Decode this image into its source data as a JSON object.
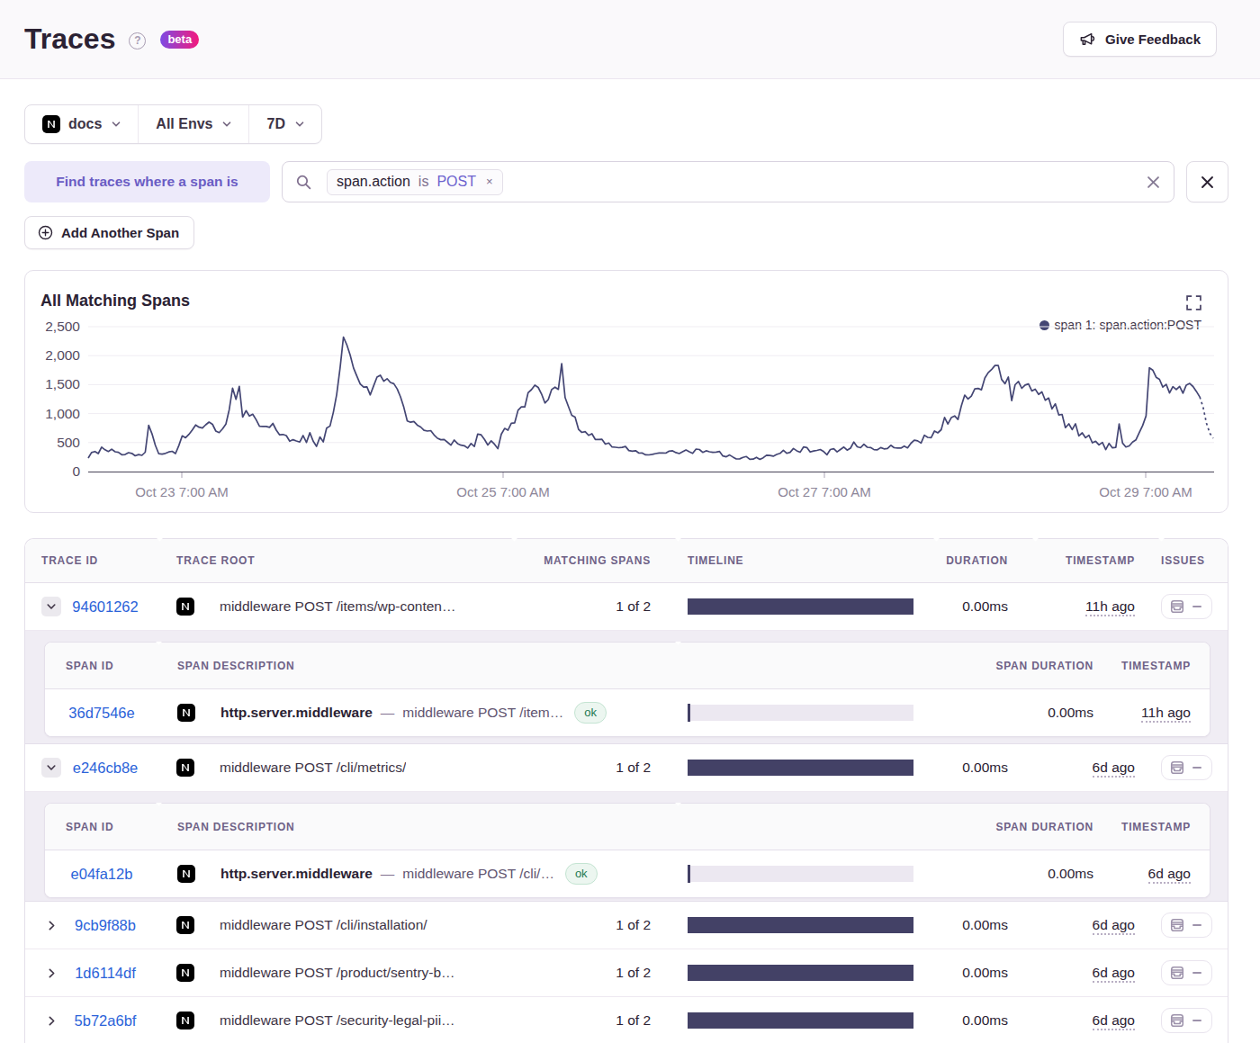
{
  "header": {
    "title": "Traces",
    "beta_label": "beta",
    "feedback_label": "Give Feedback"
  },
  "filters": {
    "project": "docs",
    "environment": "All Envs",
    "date_range": "7D"
  },
  "search": {
    "span_label": "Find traces where a span is",
    "token": {
      "key": "span.action",
      "op": "is",
      "value": "POST",
      "remove": "×"
    },
    "add_span_label": "Add Another Span"
  },
  "chart_data": {
    "type": "line",
    "title": "All Matching Spans",
    "legend": [
      {
        "name": "span 1: span.action:POST",
        "color": "#444674"
      }
    ],
    "ylim": [
      0,
      2500
    ],
    "y_ticks": [
      {
        "value": 0,
        "label": "0"
      },
      {
        "value": 500,
        "label": "500"
      },
      {
        "value": 1000,
        "label": "1,000"
      },
      {
        "value": 1500,
        "label": "1,500"
      },
      {
        "value": 2000,
        "label": "2,000"
      },
      {
        "value": 2500,
        "label": "2,500"
      }
    ],
    "x_ticks": [
      {
        "frac": 0.0832,
        "label": "Oct 23 7:00 AM"
      },
      {
        "frac": 0.3688,
        "label": "Oct 25 7:00 AM"
      },
      {
        "frac": 0.6544,
        "label": "Oct 27 7:00 AM"
      },
      {
        "frac": 0.94,
        "label": "Oct 29 7:00 AM"
      }
    ],
    "dashed_tail_points": 4,
    "values": [
      233,
      328,
      347,
      310,
      422,
      376,
      346,
      387,
      342,
      332,
      290,
      293,
      326,
      313,
      271,
      294,
      280,
      334,
      800,
      651,
      455,
      307,
      301,
      313,
      338,
      350,
      310,
      448,
      617,
      584,
      641,
      717,
      805,
      766,
      752,
      807,
      854,
      815,
      699,
      673,
      738,
      820,
      1068,
      1440,
      1247,
      1470,
      939,
      1052,
      958,
      989,
      895,
      783,
      778,
      778,
      762,
      831,
      714,
      633,
      640,
      621,
      524,
      550,
      528,
      510,
      621,
      501,
      669,
      525,
      435,
      597,
      513,
      749,
      785,
      1023,
      1330,
      1790,
      2320,
      2190,
      2015,
      1787,
      1647,
      1512,
      1457,
      1461,
      1323,
      1481,
      1630,
      1662,
      1557,
      1602,
      1538,
      1515,
      1427,
      1289,
      1108,
      874,
      851,
      864,
      801,
      768,
      711,
      698,
      707,
      632,
      574,
      549,
      553,
      505,
      457,
      544,
      483,
      455,
      446,
      406,
      485,
      433,
      648,
      634,
      554,
      458,
      530,
      471,
      394,
      645,
      744,
      714,
      832,
      842,
      1058,
      1116,
      1115,
      1360,
      1413,
      1490,
      1452,
      1338,
      1183,
      1242,
      1414,
      1457,
      1417,
      1860,
      1277,
      1121,
      971,
      938,
      729,
      675,
      689,
      625,
      652,
      555,
      554,
      556,
      474,
      492,
      424,
      419,
      412,
      417,
      434,
      364,
      351,
      360,
      318,
      320,
      289,
      288,
      298,
      311,
      320,
      322,
      319,
      353,
      358,
      328,
      311,
      342,
      372,
      340,
      314,
      388,
      381,
      330,
      359,
      342,
      330,
      336,
      346,
      269,
      254,
      285,
      250,
      218,
      219,
      244,
      260,
      211,
      214,
      245,
      210,
      237,
      283,
      276,
      265,
      295,
      313,
      367,
      315,
      332,
      398,
      358,
      333,
      424,
      415,
      337,
      355,
      365,
      381,
      344,
      291,
      380,
      394,
      340,
      381,
      422,
      369,
      404,
      509,
      427,
      412,
      472,
      420,
      414,
      379,
      375,
      413,
      391,
      397,
      453,
      411,
      406,
      406,
      440,
      408,
      489,
      542,
      530,
      491,
      628,
      590,
      586,
      699,
      668,
      722,
      934,
      820,
      930,
      959,
      897,
      1130,
      1320,
      1252,
      1301,
      1426,
      1435,
      1412,
      1615,
      1706,
      1759,
      1830,
      1830,
      1590,
      1516,
      1630,
      1224,
      1499,
      1554,
      1436,
      1492,
      1512,
      1392,
      1422,
      1331,
      1374,
      1230,
      1268,
      1081,
      1168,
      976,
      986,
      758,
      823,
      724,
      825,
      615,
      667,
      584,
      628,
      497,
      522,
      459,
      503,
      379,
      486,
      408,
      418,
      820,
      490,
      424,
      443,
      508,
      548,
      672,
      793,
      961,
      1790,
      1751,
      1628,
      1591,
      1458,
      1505,
      1357,
      1465,
      1415,
      1471,
      1352,
      1493,
      1520,
      1468,
      1383,
      1288,
      1111,
      835,
      659,
      576
    ]
  },
  "table": {
    "headers": {
      "trace_id": "Trace ID",
      "trace_root": "Trace Root",
      "matching_spans": "Matching Spans",
      "timeline": "Timeline",
      "duration": "Duration",
      "timestamp": "Timestamp",
      "issues": "Issues"
    },
    "sub_headers": {
      "span_id": "Span ID",
      "span_description": "Span Description",
      "span_duration": "Span Duration",
      "timestamp": "Timestamp"
    },
    "rows": [
      {
        "trace_id": "94601262",
        "expanded": true,
        "root": "middleware POST /items/wp-conten…",
        "matching": "1 of 2",
        "duration": "0.00ms",
        "age": "11h ago",
        "spans": [
          {
            "span_id": "36d7546e",
            "op": "http.server.middleware",
            "sep": "—",
            "desc": "middleware POST /item…",
            "status": "ok",
            "duration": "0.00ms",
            "age": "11h ago"
          }
        ]
      },
      {
        "trace_id": "e246cb8e",
        "expanded": true,
        "root": "middleware POST /cli/metrics/",
        "matching": "1 of 2",
        "duration": "0.00ms",
        "age": "6d ago",
        "spans": [
          {
            "span_id": "e04fa12b",
            "op": "http.server.middleware",
            "sep": "—",
            "desc": "middleware POST /cli/…",
            "status": "ok",
            "duration": "0.00ms",
            "age": "6d ago"
          }
        ]
      },
      {
        "trace_id": "9cb9f88b",
        "expanded": false,
        "root": "middleware POST /cli/installation/",
        "matching": "1 of 2",
        "duration": "0.00ms",
        "age": "6d ago",
        "spans": []
      },
      {
        "trace_id": "1d6114df",
        "expanded": false,
        "root": "middleware POST /product/sentry-b…",
        "matching": "1 of 2",
        "duration": "0.00ms",
        "age": "6d ago",
        "spans": []
      },
      {
        "trace_id": "5b72a6bf",
        "expanded": false,
        "root": "middleware POST /security-legal-pii…",
        "matching": "1 of 2",
        "duration": "0.00ms",
        "age": "6d ago",
        "spans": []
      }
    ]
  }
}
